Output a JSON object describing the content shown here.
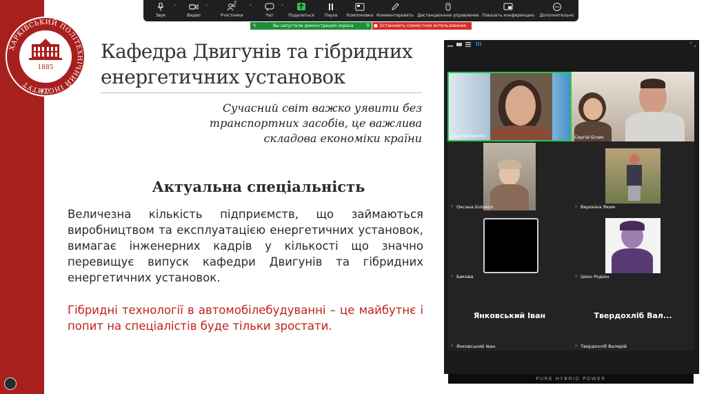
{
  "colors": {
    "brand_red": "#a8201e",
    "toolbar_bg": "#1f1f1f",
    "active_speaker": "#26c74f",
    "share_green": "#1f8f3a",
    "share_red": "#d3302a",
    "accent_blue": "#2d7cf3"
  },
  "logo": {
    "ring_text": "ХАРКІВСЬКИЙ ПОЛІТЕХНІЧНИЙ ІНСТИТУТ",
    "year": "1885",
    "acronym": "НТУ"
  },
  "toolbar": {
    "participants_count": "8",
    "items": [
      {
        "label": "Звук",
        "icon": "microphone-icon"
      },
      {
        "label": "Видео",
        "icon": "camera-icon"
      },
      {
        "label": "Участники",
        "icon": "participants-icon"
      },
      {
        "label": "Чат",
        "icon": "chat-icon"
      },
      {
        "label": "Поделиться",
        "icon": "share-screen-icon"
      },
      {
        "label": "Пауза",
        "icon": "pause-icon"
      },
      {
        "label": "Компоновка",
        "icon": "layout-icon"
      },
      {
        "label": "Комментировать",
        "icon": "pen-icon"
      },
      {
        "label": "Дистанционное управление",
        "icon": "remote-control-icon"
      },
      {
        "label": "Показать конференцию",
        "icon": "show-meeting-icon"
      },
      {
        "label": "Дополнительно",
        "icon": "more-icon"
      }
    ]
  },
  "share_banner": {
    "status": "Вы запустили демонстрацию экрана",
    "stop": "Остановить совместное использование"
  },
  "slide": {
    "title": "Кафедра Двигунів та гібридних енергетичних установок",
    "quote": "Сучасний світ важко уявити без транспортних засобів, це важлива складова економіки країни",
    "heading": "Актуальна спеціальність",
    "paragraph1": "Величезна кількість підприємств, що займаються виробництвом та експлуатацією енергетичних установок, вимагає інженерних кадрів у кількості що значно перевищує випуск кафедри Двигунів та гібридних енергетичних установок.",
    "paragraph2": "Гібридні технології в автомобілебудуванні – це майбутнє і попит на спеціалістів буде тільки зростати."
  },
  "gallery": {
    "tiles": [
      {
        "name": "Inna Mikhnenko",
        "display": "nna Mikhnenko",
        "muted": false,
        "active": true
      },
      {
        "name": "Сергій Білик",
        "muted": false,
        "active": false
      },
      {
        "name": "Оксана Біловол",
        "muted": true,
        "active": false
      },
      {
        "name": "Вероніка Яким",
        "muted": true,
        "active": false
      },
      {
        "name": "Бикова",
        "muted": true,
        "active": false
      },
      {
        "name": "Шеін Родіон",
        "muted": true,
        "active": false
      },
      {
        "name": "Янковський Іван",
        "big": "Янковський Іван",
        "muted": true,
        "active": false
      },
      {
        "name": "Твердохліб Валерій",
        "big": "Твердохліб Вал...",
        "muted": true,
        "active": false
      }
    ],
    "bottom_strip": "PURE HYBRID POWER"
  }
}
